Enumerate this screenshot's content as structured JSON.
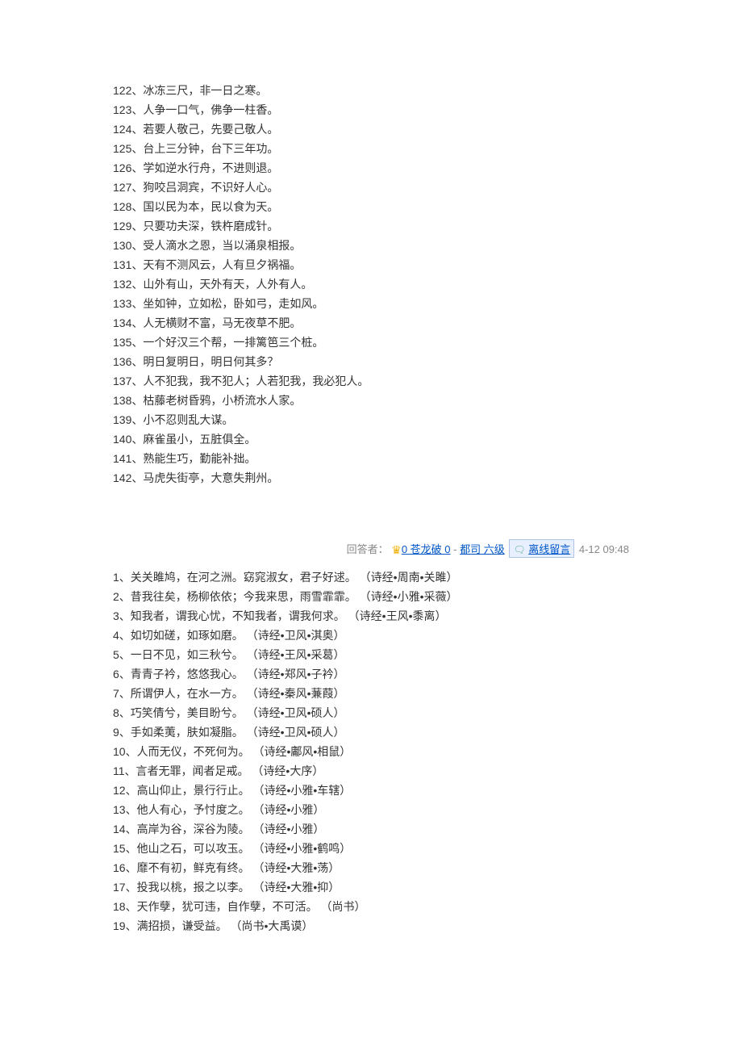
{
  "section1": [
    {
      "n": "122",
      "t": "冰冻三尺，非一日之寒。"
    },
    {
      "n": "123",
      "t": "人争一口气，佛争一柱香。"
    },
    {
      "n": "124",
      "t": "若要人敬己，先要己敬人。"
    },
    {
      "n": "125",
      "t": "台上三分钟，台下三年功。"
    },
    {
      "n": "126",
      "t": "学如逆水行舟，不进则退。"
    },
    {
      "n": "127",
      "t": "狗咬吕洞宾，不识好人心。"
    },
    {
      "n": "128",
      "t": "国以民为本，民以食为天。"
    },
    {
      "n": "129",
      "t": "只要功夫深，铁杵磨成针。"
    },
    {
      "n": "130",
      "t": "受人滴水之恩，当以涌泉相报。"
    },
    {
      "n": "131",
      "t": "天有不测风云，人有旦夕祸福。"
    },
    {
      "n": "132",
      "t": "山外有山，天外有天，人外有人。"
    },
    {
      "n": "133",
      "t": "坐如钟，立如松，卧如弓，走如风。"
    },
    {
      "n": "134",
      "t": "人无横财不富，马无夜草不肥。"
    },
    {
      "n": "135",
      "t": "一个好汉三个帮，一排篱笆三个桩。"
    },
    {
      "n": "136",
      "t": "明日复明日，明日何其多？"
    },
    {
      "n": "137",
      "t": "人不犯我，我不犯人；人若犯我，我必犯人。"
    },
    {
      "n": "138",
      "t": "枯藤老树昏鸦，小桥流水人家。"
    },
    {
      "n": "139",
      "t": "小不忍则乱大谋。"
    },
    {
      "n": "140",
      "t": "麻雀虽小，五脏俱全。"
    },
    {
      "n": "141",
      "t": "熟能生巧，勤能补拙。"
    },
    {
      "n": "142",
      "t": "马虎失街亭，大意失荆州。"
    }
  ],
  "answer": {
    "label": "回答者：",
    "user": "0 苍龙破 0",
    "sep": " - ",
    "rank": "都司  六级",
    "msg": "离线留言",
    "time": "  4-12 09:48"
  },
  "section2": [
    {
      "n": "1",
      "t": "关关雎鸠，在河之洲。窈窕淑女，君子好逑。 （诗经•周南•关雎）"
    },
    {
      "n": "2",
      "t": "昔我往矣，杨柳依依；今我来思，雨雪霏霏。 （诗经•小雅•采薇）"
    },
    {
      "n": "3",
      "t": "知我者，谓我心忧，不知我者，谓我何求。 （诗经•王风•黍离）"
    },
    {
      "n": "4",
      "t": "如切如磋，如琢如磨。 （诗经•卫风•淇奥）"
    },
    {
      "n": "5",
      "t": "一日不见，如三秋兮。 （诗经•王风•采葛）"
    },
    {
      "n": "6",
      "t": "青青子衿，悠悠我心。 （诗经•郑风•子衿）"
    },
    {
      "n": "7",
      "t": "所谓伊人，在水一方。 （诗经•秦风•蒹葭）"
    },
    {
      "n": "8",
      "t": "巧笑倩兮，美目盼兮。 （诗经•卫风•硕人）"
    },
    {
      "n": "9",
      "t": "手如柔荑，肤如凝脂。 （诗经•卫风•硕人）"
    },
    {
      "n": "10",
      "t": "人而无仪，不死何为。 （诗经•鄘风•相鼠）"
    },
    {
      "n": "11",
      "t": "言者无罪，闻者足戒。 （诗经•大序）"
    },
    {
      "n": "12",
      "t": "高山仰止，景行行止。 （诗经•小雅•车辖）"
    },
    {
      "n": "13",
      "t": "他人有心，予忖度之。 （诗经•小雅）"
    },
    {
      "n": "14",
      "t": "高岸为谷，深谷为陵。 （诗经•小雅）"
    },
    {
      "n": "15",
      "t": "他山之石，可以攻玉。 （诗经•小雅•鹤鸣）"
    },
    {
      "n": "16",
      "t": "靡不有初，鲜克有终。 （诗经•大雅•荡）"
    },
    {
      "n": "17",
      "t": "投我以桃，报之以李。 （诗经•大雅•抑）"
    },
    {
      "n": "18",
      "t": "天作孽，犹可违，自作孽，不可活。 （尚书）"
    },
    {
      "n": "19",
      "t": "满招损，谦受益。 （尚书•大禹谟）"
    }
  ]
}
